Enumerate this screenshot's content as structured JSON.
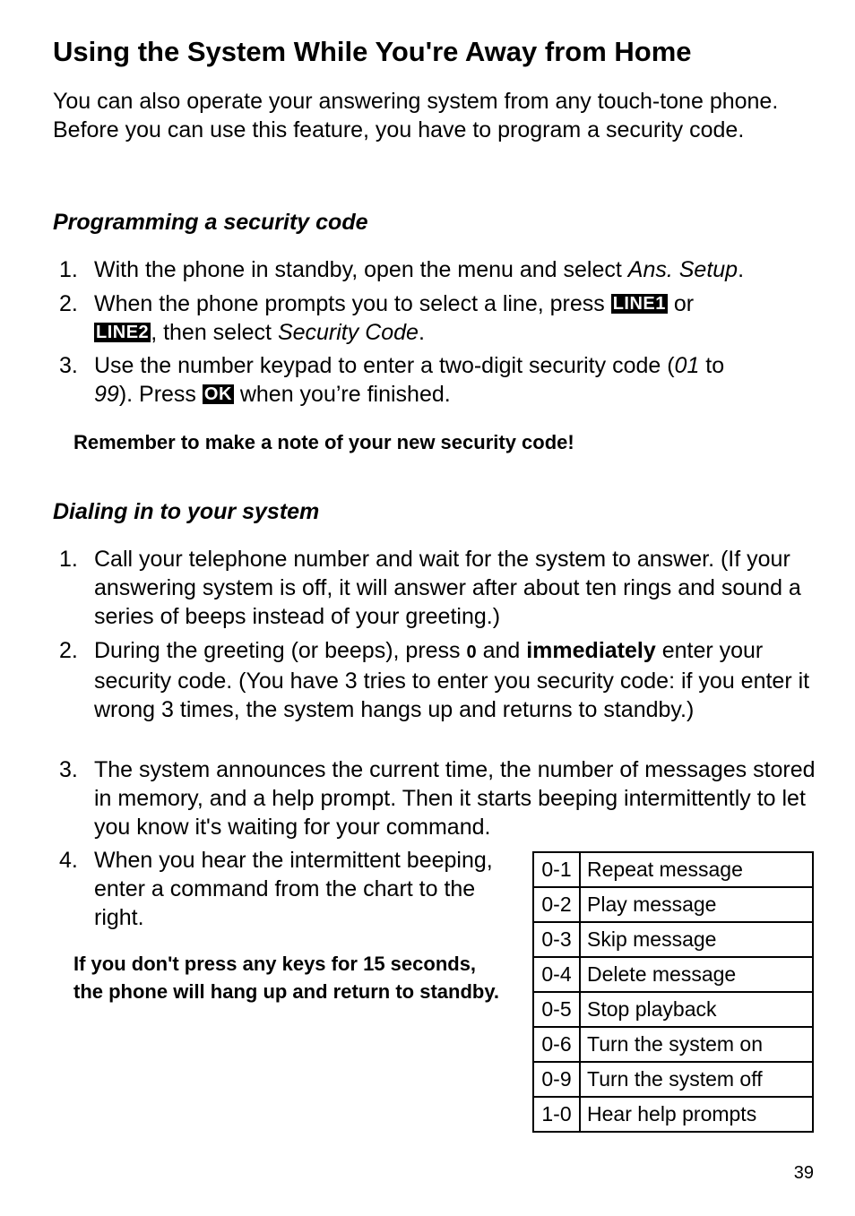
{
  "page": {
    "title": "Using the System While You're Away from Home",
    "intro": "You can also operate your answering system from any touch-tone phone. Before you can use this feature, you have to program a security code.",
    "page_number": "39"
  },
  "programming": {
    "heading": "Programming a security code",
    "steps": [
      {
        "num": "1.",
        "text_a": "With the phone in standby, open the menu and select ",
        "italic_a": "Ans. Setup",
        "text_b": "."
      },
      {
        "num": "2.",
        "text_a": "When the phone prompts you to select a line, press ",
        "key_a": "LINE1",
        "text_b": " or ",
        "key_b": "LINE2",
        "text_c": ", then select ",
        "italic_a": "Security Code",
        "text_d": "."
      },
      {
        "num": "3.",
        "text_a": "Use the number keypad to enter a two-digit security code (",
        "italic_a": "01",
        "text_b": " to ",
        "italic_b": "99",
        "text_c": "). Press ",
        "key_a": "OK",
        "text_d": " when you’re finished."
      }
    ],
    "note": "Remember to make a note of your new security code!"
  },
  "dialing": {
    "heading": "Dialing in to your system",
    "steps": [
      {
        "num": "1.",
        "text": "Call your telephone number and wait for the system to answer. (If your answering system is off, it will answer after about ten rings and sound a series of beeps instead of your greeting.)"
      },
      {
        "num": "2.",
        "text_a": "During the greeting (or beeps), press ",
        "key": "0",
        "text_b": " and ",
        "bold": "immediately",
        "text_c": " enter your security code. (You have 3 tries to enter you security code: if you enter it wrong 3 times, the system hangs up and returns to standby.)"
      },
      {
        "num": "3.",
        "text": "The system announces the current time, the number of messages stored in memory, and a help prompt. Then it starts beeping intermittently to let you know it's waiting for your command."
      },
      {
        "num": "4.",
        "text": "When you hear the intermittent beeping, enter a command from the chart to the right."
      }
    ],
    "note": "If you don't press any keys for 15 seconds, the phone will hang up and return to standby."
  },
  "commands": [
    {
      "code": "0-1",
      "action": "Repeat message"
    },
    {
      "code": "0-2",
      "action": "Play message"
    },
    {
      "code": "0-3",
      "action": "Skip message"
    },
    {
      "code": "0-4",
      "action": "Delete message"
    },
    {
      "code": "0-5",
      "action": "Stop playback"
    },
    {
      "code": "0-6",
      "action": "Turn the system on"
    },
    {
      "code": "0-9",
      "action": "Turn the system off"
    },
    {
      "code": "1-0",
      "action": "Hear help prompts"
    }
  ]
}
